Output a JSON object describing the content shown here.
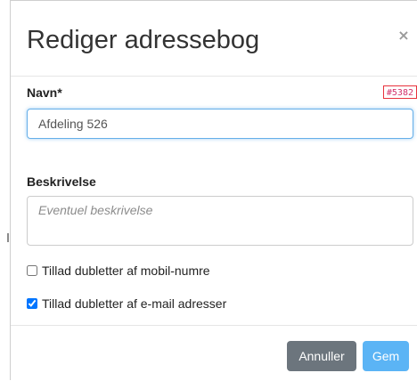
{
  "dialog": {
    "title": "Rediger adressebog",
    "close_label": "×"
  },
  "form": {
    "name_label": "Navn*",
    "record_id": "#5382",
    "name_value": "Afdeling 526",
    "description_label": "Beskrivelse",
    "description_placeholder": "Eventuel beskrivelse",
    "description_value": "",
    "checkboxes": [
      {
        "label": "Tillad dubletter af mobil-numre",
        "checked": false
      },
      {
        "label": "Tillad dubletter af e-mail adresser",
        "checked": true
      }
    ]
  },
  "footer": {
    "cancel_label": "Annuller",
    "save_label": "Gem"
  },
  "colors": {
    "primary": "#5bb4f5",
    "secondary": "#6c757d",
    "focus_border": "#66afe9",
    "badge_border": "#e8323c"
  },
  "icons": {
    "close": "close-icon"
  }
}
